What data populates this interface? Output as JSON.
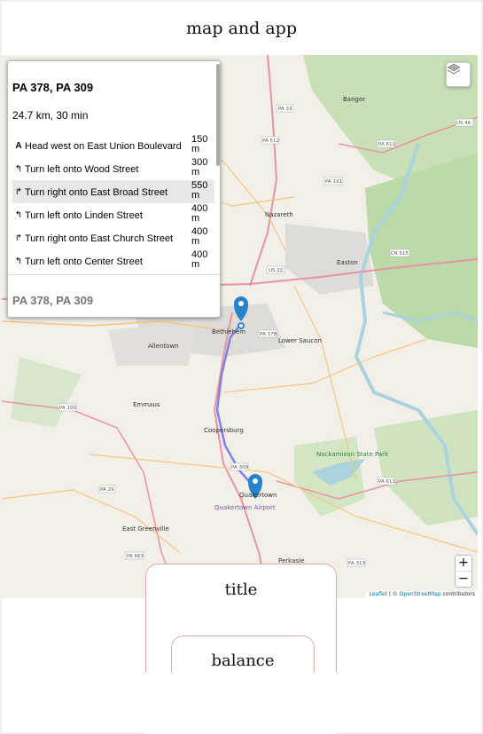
{
  "app": {
    "title": "map and app"
  },
  "map": {
    "zoom_in": "+",
    "zoom_out": "−",
    "attribution": {
      "leaflet": "Leaflet",
      "sep": " | © ",
      "osm": "OpenStreetMap",
      "tail": " contributors"
    },
    "places": [
      {
        "id": "bangor",
        "label": "Bangor"
      },
      {
        "id": "nazareth",
        "label": "Nazareth"
      },
      {
        "id": "easton",
        "label": "Easton"
      },
      {
        "id": "bethlehem",
        "label": "Bethlehem"
      },
      {
        "id": "allentown",
        "label": "Allentown"
      },
      {
        "id": "lower-saucon",
        "label": "Lower Saucon"
      },
      {
        "id": "emmaus",
        "label": "Emmaus"
      },
      {
        "id": "coopersburg",
        "label": "Coopersburg"
      },
      {
        "id": "quakertown",
        "label": "Quakertown"
      },
      {
        "id": "east-greenville",
        "label": "East Greenville"
      },
      {
        "id": "perkasie",
        "label": "Perkasie"
      },
      {
        "id": "nockamixon",
        "label": "Nockamixon State Park"
      },
      {
        "id": "airport",
        "label": "Quakertown Airport"
      }
    ],
    "shields": [
      "PA 33",
      "US 22",
      "PA 378",
      "PA 309",
      "PA 611",
      "PA 512",
      "PA 191",
      "CR 515",
      "US 46",
      "PA 100",
      "PA 29",
      "PA 663",
      "PA 313",
      "PA 611"
    ]
  },
  "routing": {
    "route_name": "PA 378, PA 309",
    "summary": "24.7 km, 30 min",
    "instructions": [
      {
        "icon": "A",
        "text": "Head west on East Union Boulevard",
        "distance": "150 m"
      },
      {
        "icon": "↰",
        "text": "Turn left onto Wood Street",
        "distance": "300 m"
      },
      {
        "icon": "↱",
        "text": "Turn right onto East Broad Street",
        "distance": "550 m"
      },
      {
        "icon": "↰",
        "text": "Turn left onto Linden Street",
        "distance": "400 m"
      },
      {
        "icon": "↱",
        "text": "Turn right onto East Church Street",
        "distance": "400 m"
      },
      {
        "icon": "↰",
        "text": "Turn left onto Center Street",
        "distance": "400 m"
      }
    ],
    "alt_route_name": "PA 378, PA 309"
  },
  "card": {
    "title": "title",
    "balance_label": "balance"
  },
  "colors": {
    "route": "#6c6cf0",
    "marker": "#2a81cb",
    "road_red": "#e892a2",
    "road_orange": "#f7c57f",
    "water": "#aad3df",
    "forest": "#b7d5a8",
    "card_border": "#e8a8a8"
  }
}
